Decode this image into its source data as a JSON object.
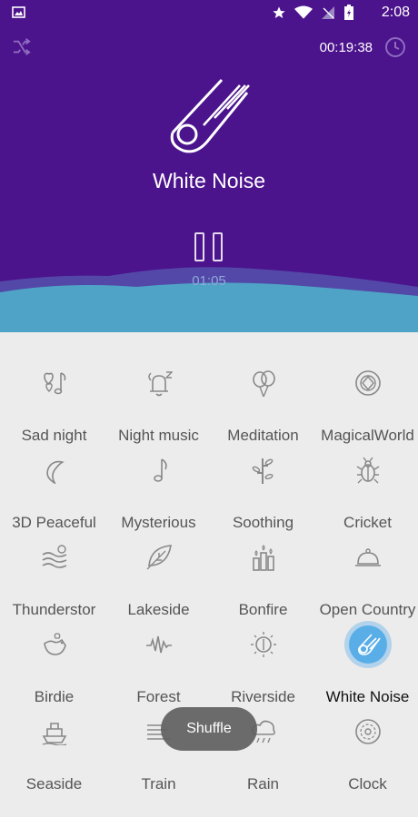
{
  "status_bar": {
    "time": "2:08"
  },
  "header": {
    "timer": "00:19:38"
  },
  "now_playing": {
    "title": "White Noise",
    "elapsed": "01:05"
  },
  "sounds": [
    {
      "label": "Sad night",
      "icon": "hearts-music-note-icon"
    },
    {
      "label": "Night music",
      "icon": "bell-moon-icon"
    },
    {
      "label": "Meditation",
      "icon": "balloons-icon"
    },
    {
      "label": "MagicalWorld",
      "icon": "crystal-ball-icon"
    },
    {
      "label": "3D Peaceful",
      "icon": "crescent-moon-icon"
    },
    {
      "label": "Mysterious",
      "icon": "music-note-icon"
    },
    {
      "label": "Soothing",
      "icon": "bamboo-icon"
    },
    {
      "label": "Cricket",
      "icon": "bug-icon"
    },
    {
      "label": "Thunderstor",
      "icon": "storm-waves-icon"
    },
    {
      "label": "Lakeside",
      "icon": "leaf-icon"
    },
    {
      "label": "Bonfire",
      "icon": "candles-icon"
    },
    {
      "label": "Open Country",
      "icon": "bell-dish-icon"
    },
    {
      "label": "Birdie",
      "icon": "bird-icon"
    },
    {
      "label": "Forest",
      "icon": "sound-wave-icon"
    },
    {
      "label": "Riverside",
      "icon": "sun-icon"
    },
    {
      "label": "White Noise",
      "icon": "comet-icon",
      "active": true
    },
    {
      "label": "Seaside",
      "icon": "ship-icon"
    },
    {
      "label": "Train",
      "icon": "train-icon"
    },
    {
      "label": "Rain",
      "icon": "rain-cloud-icon"
    },
    {
      "label": "Clock",
      "icon": "clock-icon"
    }
  ],
  "toast": {
    "text": "Shuffle"
  },
  "colors": {
    "header_bg": "#4b138c",
    "wave": "#4ea3c6",
    "active": "#5aaee8"
  }
}
